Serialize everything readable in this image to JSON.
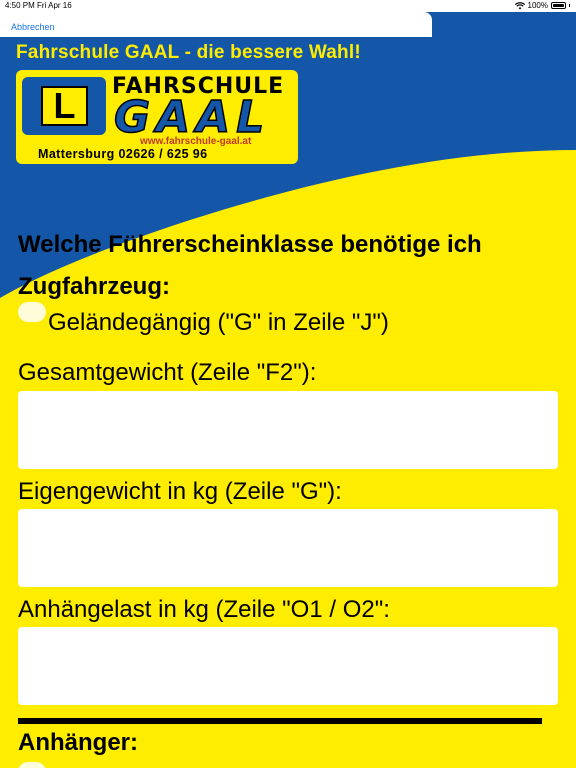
{
  "status_bar": {
    "time": "4:50 PM",
    "date": "Fri Apr 16",
    "battery": "100%"
  },
  "nav": {
    "cancel_label": "Abbrechen"
  },
  "header": {
    "tagline": "Fahrschule GAAL - die bessere Wahl!",
    "logo_letter": "L",
    "logo_word1": "FAHRSCHULE",
    "logo_word2": "GAAL",
    "logo_website": "www.fahrschule-gaal.at",
    "logo_address": "Mattersburg   02626 / 625 96",
    "colors": {
      "blue": "#1456a8",
      "yellow": "#ffed00"
    }
  },
  "form": {
    "question": "Welche Führerscheinklasse benötige ich Zugfahrzeug:",
    "offroad_option": "Geländegängig (\"G\" in Zeile \"J\")",
    "total_weight_label": "Gesamtgewicht (Zeile \"F2\"):",
    "total_weight_value": "",
    "own_weight_label": "Eigengewicht in kg (Zeile \"G\"):",
    "own_weight_value": "",
    "trailer_load_label": "Anhängelast in kg (Zeile \"O1 / O2\":",
    "trailer_load_value": "",
    "trailer_section": "Anhänger:"
  }
}
